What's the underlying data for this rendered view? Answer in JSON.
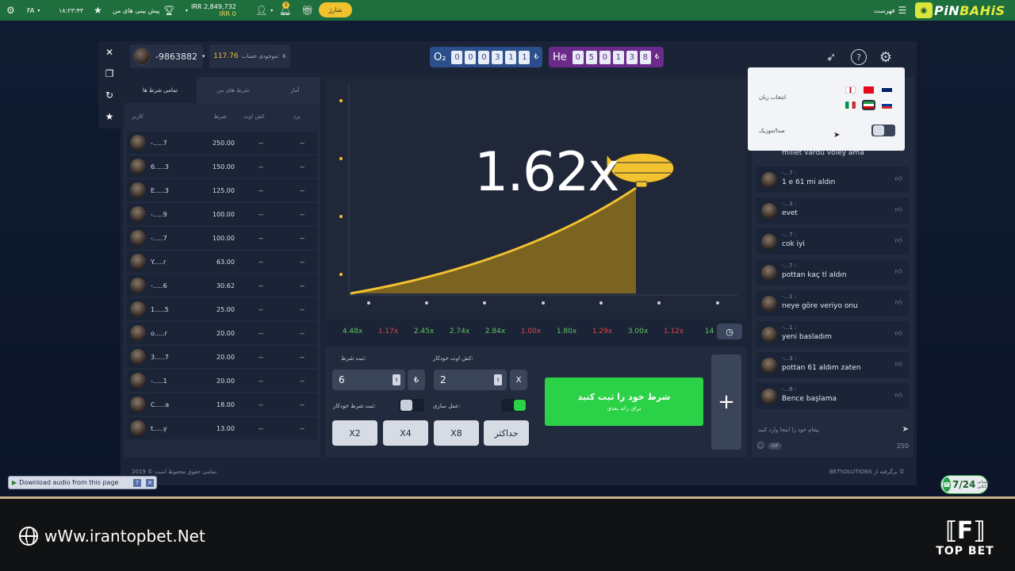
{
  "topnav": {
    "time": "۱۸:۲۳:۴۳",
    "lang": "FA",
    "favorites_label": "پیش بینی های من",
    "balance_main": "IRR 2,849,732",
    "balance_bonus": "IRR 0",
    "notif_count": "3",
    "deposit_label": "شارژ",
    "menu_label": "فهرست",
    "logo_a": "PiN",
    "logo_b": "BAHiS"
  },
  "side_buttons": [
    "✕",
    "❐",
    "↻",
    "★"
  ],
  "game": {
    "user_id": "-9863882",
    "balance_label": "موجودی حساب:",
    "balance_value": "117.76",
    "currency_symbol": "₺",
    "counter_o2_label": "O₂",
    "counter_o2_digits": [
      "0",
      "0",
      "0",
      "3",
      "1",
      "1"
    ],
    "counter_he_label": "He",
    "counter_he_digits": [
      "0",
      "5",
      "0",
      "1",
      "3",
      "8"
    ],
    "multiplier": "1.62x"
  },
  "bets_panel": {
    "tabs": [
      "آمار",
      "شرط های من",
      "تمامی شرط ها"
    ],
    "columns": [
      "کاربر",
      "شرط",
      "کش اوت",
      "برد"
    ],
    "rows": [
      {
        "user": "-.....7",
        "bet": "250.00",
        "coef": "--",
        "win": "--"
      },
      {
        "user": "6.....3",
        "bet": "150.00",
        "coef": "--",
        "win": "--"
      },
      {
        "user": "E.....3",
        "bet": "125.00",
        "coef": "--",
        "win": "--"
      },
      {
        "user": "-.....9",
        "bet": "100.00",
        "coef": "--",
        "win": "--"
      },
      {
        "user": "-.....7",
        "bet": "100.00",
        "coef": "--",
        "win": "--"
      },
      {
        "user": "Y.....r",
        "bet": "63.00",
        "coef": "--",
        "win": "--"
      },
      {
        "user": "-.....6",
        "bet": "30.62",
        "coef": "--",
        "win": "--"
      },
      {
        "user": "1.....5",
        "bet": "25.00",
        "coef": "--",
        "win": "--"
      },
      {
        "user": "o.....r",
        "bet": "20.00",
        "coef": "--",
        "win": "--"
      },
      {
        "user": "3.....7",
        "bet": "20.00",
        "coef": "--",
        "win": "--"
      },
      {
        "user": "-.....1",
        "bet": "20.00",
        "coef": "--",
        "win": "--"
      },
      {
        "user": "C.....a",
        "bet": "18.00",
        "coef": "--",
        "win": "--"
      },
      {
        "user": "t.....y",
        "bet": "13.00",
        "coef": "--",
        "win": "--"
      }
    ],
    "footer": "تمامی حقوق محفوظ است © 2019"
  },
  "history": [
    {
      "v": "4.48x",
      "color": "#5ec45e"
    },
    {
      "v": "1.17x",
      "color": "#e04646"
    },
    {
      "v": "2.45x",
      "color": "#5ec45e"
    },
    {
      "v": "2.74x",
      "color": "#5ec45e"
    },
    {
      "v": "2.84x",
      "color": "#5ec45e"
    },
    {
      "v": "1.00x",
      "color": "#e04646"
    },
    {
      "v": "1.80x",
      "color": "#5ec45e"
    },
    {
      "v": "1.29x",
      "color": "#e04646"
    },
    {
      "v": "3.00x",
      "color": "#5ec45e"
    },
    {
      "v": "1.12x",
      "color": "#e04646"
    },
    {
      "v": "14",
      "color": "#5ec45e"
    }
  ],
  "bet_controls": {
    "bet_label": "ثبت شرط:",
    "bet_value": "6",
    "cashout_label": "کش اوت خودکار:",
    "cashout_value": "2",
    "auto_bet_label": "ثبت شرط خودکار:",
    "auto_cashout_label": "عمل سازی:",
    "currency_btn": "₺",
    "x_btn": "X",
    "quick": [
      "X2",
      "X4",
      "X8",
      "حداکثر"
    ],
    "place_l1": "شرط خود را ثبت کنید",
    "place_l2": "برای راند بعدی",
    "plus": "+"
  },
  "chat": {
    "partial_top": "millet vardu voley ama",
    "messages": [
      {
        "user": "-...7 :",
        "text": "1 e 61 mi aldın"
      },
      {
        "user": "-...3 :",
        "text": "evet"
      },
      {
        "user": "-...7 :",
        "text": "cok iyi"
      },
      {
        "user": "-...7 :",
        "text": "pottan kaç tl aldın"
      },
      {
        "user": "-...1 :",
        "text": "neye göre veriyo onu"
      },
      {
        "user": "-...1 :",
        "text": "yeni basladım"
      },
      {
        "user": "-...3 :",
        "text": "pottan 61 aldım zaten"
      },
      {
        "user": "-...6 :",
        "text": "Bence başlama"
      }
    ],
    "input_placeholder": "پیغام خود را اینجا وارد کنید",
    "gif_label": "GIF",
    "char_limit": "250",
    "footer": "BETSOLUTIONS برگرفته از ©"
  },
  "settings_popup": {
    "language_label": "انتخاب زبان",
    "sound_label": "صدا/موزیک"
  },
  "overlays": {
    "download_audio": "Download audio from this page",
    "support_small": "پشتیبانی آنلاین",
    "support_big": "7/24",
    "site": "wWw.irantopbet.Net",
    "brand": "TOP BET"
  },
  "colors": {
    "topbar": "#1f6e3d",
    "accent_gold": "#f2c231",
    "place_green": "#2bd146"
  }
}
